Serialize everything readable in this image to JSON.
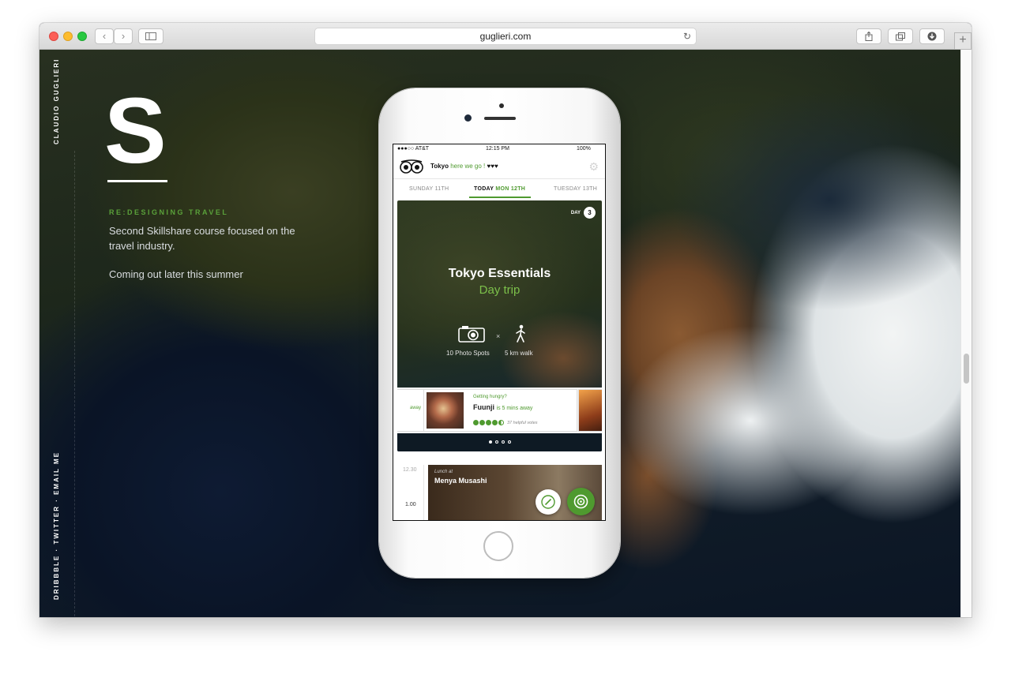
{
  "browser": {
    "url": "guglieri.com"
  },
  "site": {
    "author_vertical": "CLAUDIO GUGLIERI",
    "social_vertical": "DRIBBBLE  ·  TWITTER  ·  EMAIL ME",
    "big_letter": "S",
    "section_label": "RE:DESIGNING TRAVEL",
    "description": "Second Skillshare course focused on the travel industry.",
    "note": "Coming out later this summer",
    "accent_color": "#5aa13a"
  },
  "phone_app": {
    "status": {
      "carrier": "●●●○○ AT&T",
      "time": "12:15 PM",
      "battery": "100%"
    },
    "header": {
      "city": "Tokyo",
      "tagline": "here we go !",
      "hearts": "♥♥♥"
    },
    "days": {
      "prev": "SUNDAY 11TH",
      "today_label": "TODAY",
      "today_date": "MON 12TH",
      "next": "TUESDAY 13TH"
    },
    "card": {
      "day_label": "DAY",
      "day_number": "3",
      "title": "Tokyo Essentials",
      "subtitle": "Day trip",
      "separator": "×",
      "stat_photo": "10 Photo Spots",
      "stat_walk": "5 km walk"
    },
    "suggestion": {
      "left_fragment": "away",
      "prompt": "Getting hungry?",
      "name": "Fuunji",
      "distance": "is 5 mins away",
      "rating": 4.5,
      "votes": "37 helpful votes"
    },
    "timeline": {
      "time1": "12.30",
      "time2": "1.00",
      "lunch_label": "Lunch at",
      "lunch_name": "Menya Musashi"
    }
  }
}
